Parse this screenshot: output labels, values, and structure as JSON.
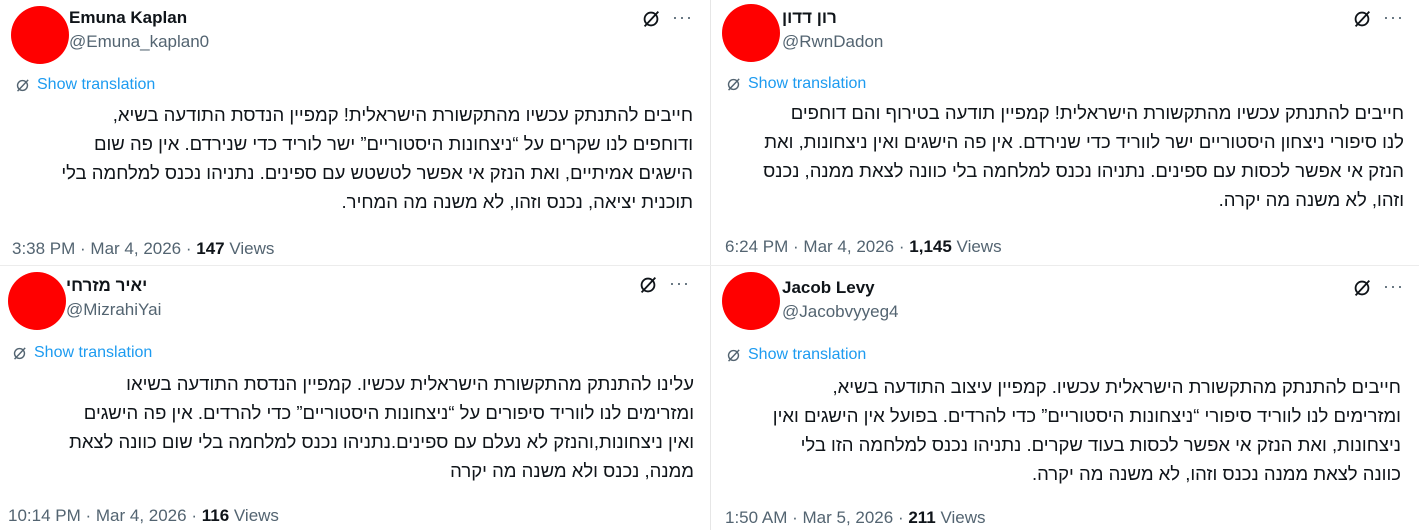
{
  "tweets": [
    {
      "name": "Emuna Kaplan",
      "handle": "@Emuna_kaplan0",
      "translate": "Show translation",
      "lines": [
        "חייבים להתנתק עכשיו מהתקשורת הישראלית! קמפיין הנדסת התודעה בשיא,",
        "ודוחפים לנו שקרים על “ניצחונות היסטוריים” ישר לוריד כדי שנירדם. אין פה שום",
        "הישגים אמיתיים, ואת הנזק אי אפשר לטשטש עם ספינים. נתניהו נכנס למלחמה בלי",
        "תוכנית יציאה, נכנס וזהו, לא משנה מה המחיר."
      ],
      "time": "3:38 PM",
      "date": "Mar 4, 2026",
      "views_count": "147",
      "views_label": "Views"
    },
    {
      "name": "רון דדון",
      "handle": "@RwnDadon",
      "translate": "Show translation",
      "lines": [
        "חייבים להתנתק עכשיו מהתקשורת הישראלית! קמפיין תודעה בטירוף והם דוחפים",
        "לנו סיפורי ניצחון היסטוריים ישר לווריד כדי שנירדם. אין פה הישגים ואין ניצחונות, ואת",
        "הנזק אי אפשר לכסות עם ספינים. נתניהו נכנס למלחמה בלי כוונה לצאת ממנה, נכנס",
        "וזהו, לא משנה מה יקרה."
      ],
      "time": "6:24 PM",
      "date": "Mar 4, 2026",
      "views_count": "1,145",
      "views_label": "Views"
    },
    {
      "name": "יאיר מזרחי",
      "handle": "@MizrahiYai",
      "translate": "Show translation",
      "lines": [
        "עלינו להתנתק מהתקשורת הישראלית עכשיו. קמפיין הנדסת התודעה בשיאו",
        "ומזרימים לנו לווריד סיפורים על “ניצחונות היסטוריים” כדי להרדים. אין פה הישגים",
        "ואין ניצחונות,והנזק לא נעלם עם ספינים.נתניהו נכנס למלחמה בלי שום כוונה לצאת",
        "ממנה, נכנס ולא משנה מה יקרה"
      ],
      "time": "10:14 PM",
      "date": "Mar 4, 2026",
      "views_count": "116",
      "views_label": "Views"
    },
    {
      "name": "Jacob Levy",
      "handle": "@Jacobvyyeg4",
      "translate": "Show translation",
      "lines": [
        "חייבים להתנתק מהתקשורת הישראלית עכשיו. קמפיין עיצוב התודעה בשיא,",
        "ומזרימים לנו לווריד סיפורי “ניצחונות היסטוריים” כדי להרדים. בפועל אין הישגים ואין",
        "ניצחונות, ואת הנזק אי אפשר לכסות בעוד שקרים. נתניהו נכנס למלחמה הזו בלי",
        "כוונה לצאת ממנה  נכנס וזהו, לא משנה מה יקרה."
      ],
      "time": "1:50 AM",
      "date": "Mar 5, 2026",
      "views_count": "211",
      "views_label": "Views"
    }
  ],
  "separator": " · ",
  "colors": {
    "avatar": "#ff0000",
    "link": "#1d9bf0",
    "muted": "#536471",
    "text": "#0f1419"
  },
  "icons": {
    "grok": "grok-icon",
    "more": "more-icon",
    "translate": "translate-icon"
  }
}
